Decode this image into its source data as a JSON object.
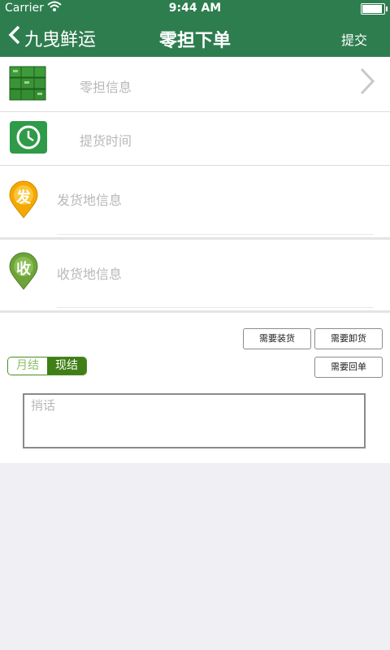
{
  "status": {
    "carrier": "Carrier",
    "time": "9:44 AM",
    "battery_level": 1.0
  },
  "nav": {
    "back_label": "九曳鲜运",
    "title": "零担下单",
    "submit_label": "提交"
  },
  "rows": {
    "cargo": "零担信息",
    "pickup_time": "提货时间",
    "sender": "发货地信息",
    "sender_badge": "发",
    "receiver": "收货地信息",
    "receiver_badge": "收"
  },
  "options": {
    "need_loading": "需要装货",
    "need_unloading": "需要卸货",
    "need_receipt": "需要回单",
    "payment": [
      "月结",
      "现结"
    ],
    "payment_selected": "现结"
  },
  "note": {
    "placeholder": "捎话"
  },
  "colors": {
    "nav_bg": "#2e7d4f",
    "accent": "#3f7f16",
    "sender_pin": "#f5a800",
    "receiver_pin": "#6ea33a"
  },
  "icons": {
    "cargo": "stacked-boxes-icon",
    "pickup": "clock-icon",
    "sender": "map-pin-icon",
    "receiver": "map-pin-icon"
  }
}
